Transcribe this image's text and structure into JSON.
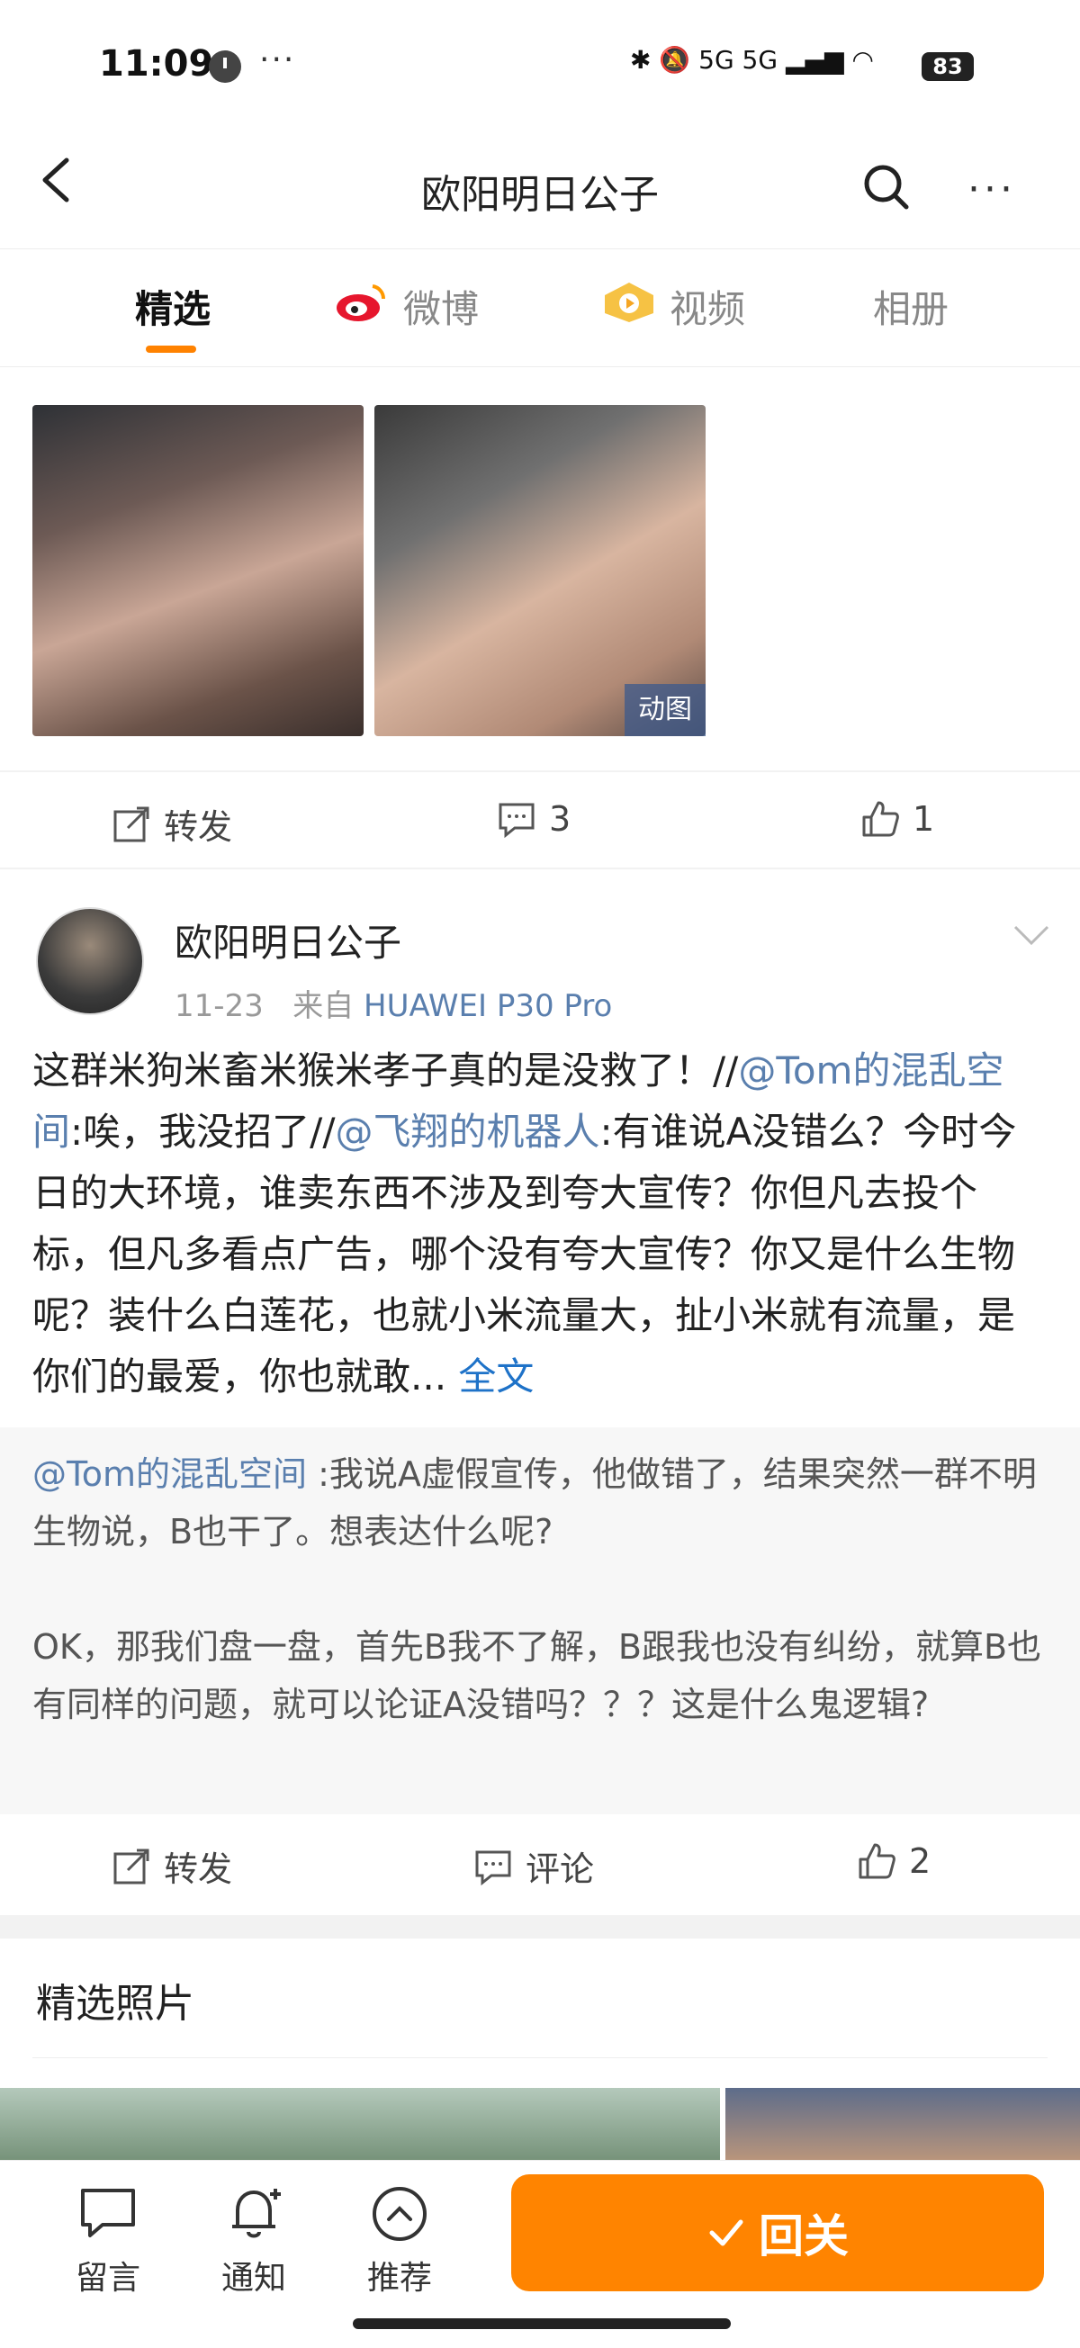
{
  "status": {
    "time": "11:09",
    "battery": "83",
    "network": "5G 5G"
  },
  "nav": {
    "title": "欧阳明日公子"
  },
  "tabs": [
    {
      "label": "精选",
      "active": true
    },
    {
      "label": "微博"
    },
    {
      "label": "视频"
    },
    {
      "label": "相册"
    }
  ],
  "feed1": {
    "gif_badge": "动图",
    "actions": {
      "repost": "转发",
      "comments": "3",
      "likes": "1"
    }
  },
  "post": {
    "author": "欧阳明日公子",
    "date": "11-23",
    "source_prefix": "来自",
    "device": "HUAWEI P30 Pro",
    "body": {
      "p1": "这群米狗米畜米猴米孝子真的是没救了！//",
      "m1": "@Tom的混乱空间",
      "p2": ":唉，我没招了//",
      "m2": "@飞翔的机器人",
      "p3": ":有谁说A没错么？今时今日的大环境，谁卖东西不涉及到夸大宣传？你但凡去投个标，但凡多看点广告，哪个没有夸大宣传？你又是什么生物呢？装什么白莲花，也就小米流量大，扯小米就有流量，是你们的最爱，你也就敢...",
      "full": "全文"
    },
    "quote": {
      "mention": "@Tom的混乱空间",
      "t1": ":我说A虚假宣传，他做错了，结果突然一群不明生物说，B也干了。想表达什么呢?",
      "t2": "OK，那我们盘一盘，首先B我不了解，B跟我也没有纠纷，就算B也有同样的问题，就可以论证A没错吗？？？这是什么鬼逻辑?"
    },
    "actions": {
      "repost": "转发",
      "comment": "评论",
      "likes": "2"
    }
  },
  "photos_section": {
    "title": "精选照片"
  },
  "bottom": {
    "message": "留言",
    "notify": "通知",
    "recommend": "推荐",
    "follow": "回关"
  },
  "colors": {
    "accent": "#ff8200",
    "link": "#5a7fae",
    "follow_bg": "#ff8400"
  }
}
